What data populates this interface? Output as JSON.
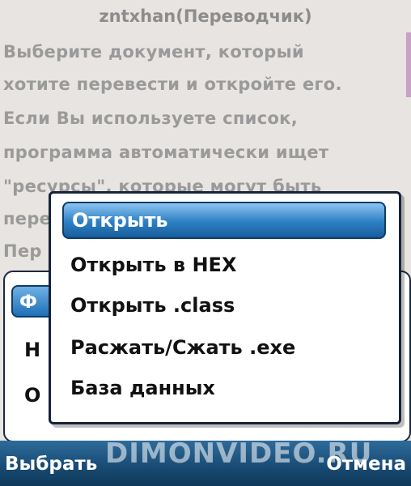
{
  "background": {
    "title": "zntxhan(Переводчик)",
    "paragraph_lines": [
      "  Выберите документ, который",
      "хотите перевести и откройте его.",
      "Если Вы используете список,",
      "программа автоматически ищет",
      "\"ресурсы\", которые могут быть",
      "пере",
      "Пер"
    ],
    "dialog": {
      "tab_label": "Ф",
      "row_labels": [
        "Н",
        "О"
      ]
    }
  },
  "menu": {
    "items": [
      {
        "label": "Открыть",
        "selected": true
      },
      {
        "label": "Открыть в HEX",
        "selected": false
      },
      {
        "label": "Открыть .class",
        "selected": false
      },
      {
        "label": "Расжать/Сжать .exe",
        "selected": false
      },
      {
        "label": "База данных",
        "selected": false
      }
    ]
  },
  "softkeys": {
    "left": "Выбрать",
    "right": "Отмена"
  },
  "watermark": "DIMONVIDEO.RU",
  "colors": {
    "accent": "#2c7fc4",
    "softbar": "#184a73"
  }
}
